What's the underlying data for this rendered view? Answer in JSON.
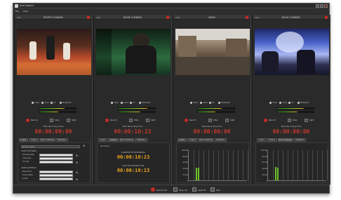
{
  "window": {
    "title": "Avid Capture"
  },
  "menu": [
    "File",
    "Help"
  ],
  "panels": [
    {
      "num": "CH1",
      "name": "SPORTS CHANNEL",
      "thumb": "sports-basketball-thumbnail",
      "checks": [
        "Video",
        "Audio",
        "CC",
        "Metadata"
      ],
      "meters": [
        0.7,
        0.52
      ],
      "actions": [
        "Record",
        "Stop",
        "Split"
      ],
      "trt_label": "Total Recording Time",
      "trt": "00:00:00:00",
      "tabs": [
        "Input",
        "Output",
        "Record Settings",
        "Metadata"
      ],
      "active_tab": 0
    },
    {
      "num": "CH2",
      "name": "MOVIE CHANNEL",
      "thumb": "movie-scene-thumbnail",
      "checks": [
        "Video",
        "Audio",
        "CC",
        "Metadata"
      ],
      "meters": [
        0.78,
        0.6
      ],
      "actions": [
        "Record",
        "Stop",
        "Split"
      ],
      "trt_label": "Total Recording Time",
      "trt": "00:00:10:23",
      "tabs": [
        "Input",
        "Output",
        "Record Settings",
        "Metadata"
      ],
      "active_tab": 1,
      "status": "Recording",
      "clip_label": "DURATION OF RECORDING",
      "clip_time": "00:00:10:23",
      "split_label": "SPLIT RECORDING TIME",
      "split_time": "00:00:10:13"
    },
    {
      "num": "CH3",
      "name": "NEWS",
      "thumb": "news-rubble-thumbnail",
      "checks": [
        "Video",
        "Audio",
        "CC",
        "Metadata"
      ],
      "meters": [
        0.65,
        0.48
      ],
      "actions": [
        "Record",
        "Stop",
        "Split"
      ],
      "trt_label": "Total Recording Time",
      "trt": "00:00:00:00",
      "tabs": [
        "Input",
        "Output",
        "Record Settings",
        "Metadata"
      ],
      "active_tab": 0,
      "chart_yticks": [
        "100,000",
        "80,000",
        "60,000",
        "40,000",
        "20,000",
        "0"
      ],
      "chart_bars": [
        0.42,
        0.4
      ]
    },
    {
      "num": "CH4",
      "name": "MUSIC CHANNEL",
      "thumb": "concert-stage-thumbnail",
      "checks": [
        "Video",
        "Audio",
        "CC",
        "Metadata"
      ],
      "meters": [
        0.74,
        0.55
      ],
      "actions": [
        "Record",
        "Stop",
        "Split"
      ],
      "trt_label": "Total Recording Time",
      "trt": "00:00:00:00",
      "tabs": [
        "Input",
        "Output",
        "Record Settings",
        "Metadata"
      ],
      "active_tab": 2,
      "chart_yticks": [
        "100,000",
        "80,000",
        "60,000",
        "40,000",
        "20,000",
        "0"
      ],
      "chart_bars": [
        0.44,
        0.42
      ]
    }
  ],
  "panel1_settings": {
    "source_label": "Source name",
    "audio_label": "AUDIO SETTINGS",
    "rows": [
      "Sample Rate",
      "Channels",
      "Format"
    ],
    "video_label": "VIDEO SETTINGS",
    "vrows": [
      "Resolution",
      "Frame Rate",
      "Codec"
    ]
  },
  "bottom": [
    "Record All",
    "Stop All",
    "Split All",
    "Exit"
  ],
  "colors": {
    "record": "#c62b22",
    "timer": "#c0392b",
    "clip": "#e8a21f",
    "meter": "#6fbf2a"
  }
}
